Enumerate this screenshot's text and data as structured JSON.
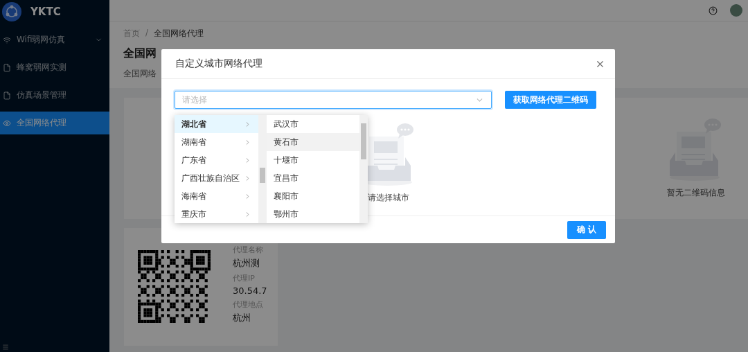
{
  "sidebar": {
    "logo_text": "YKTC",
    "items": [
      {
        "label": "Wifi弱网仿真",
        "kind": "wifi",
        "expanded": false,
        "selected": false
      },
      {
        "label": "蜂窝弱网实测",
        "kind": "page",
        "selected": false
      },
      {
        "label": "仿真场景管理",
        "kind": "page",
        "selected": false
      },
      {
        "label": "全国网络代理",
        "kind": "network",
        "selected": true
      }
    ]
  },
  "breadcrumb": [
    "首页",
    "全国网络代理"
  ],
  "breadcrumb_separator": "/",
  "page_title": "全国网",
  "description": "全国网络",
  "panel": {
    "empty_text": "暂无二维码信息"
  },
  "proxy_card": {
    "fields": [
      {
        "label": "代理名称",
        "value": "杭州测"
      },
      {
        "label": "代理IP",
        "value": "30.54.7"
      },
      {
        "label": "代理地点",
        "value": "杭州"
      }
    ]
  },
  "dialog": {
    "title": "自定义城市网络代理",
    "select": {
      "placeholder": "请选择",
      "focused": true
    },
    "action_button": "获取网络代理二维码",
    "cascader": {
      "provinces": [
        {
          "label": "湖北省",
          "selected": true
        },
        {
          "label": "湖南省",
          "selected": false
        },
        {
          "label": "广东省",
          "selected": false
        },
        {
          "label": "广西壮族自治区",
          "selected": false
        },
        {
          "label": "海南省",
          "selected": false
        },
        {
          "label": "重庆市",
          "selected": false
        }
      ],
      "cities": [
        {
          "label": "武汉市",
          "hovered": false
        },
        {
          "label": "黄石市",
          "hovered": true
        },
        {
          "label": "十堰市",
          "hovered": false
        },
        {
          "label": "宜昌市",
          "hovered": false
        },
        {
          "label": "襄阳市",
          "hovered": false
        },
        {
          "label": "鄂州市",
          "hovered": false
        }
      ]
    },
    "empty_text": "请选择城市",
    "confirm_button": "确 认"
  }
}
